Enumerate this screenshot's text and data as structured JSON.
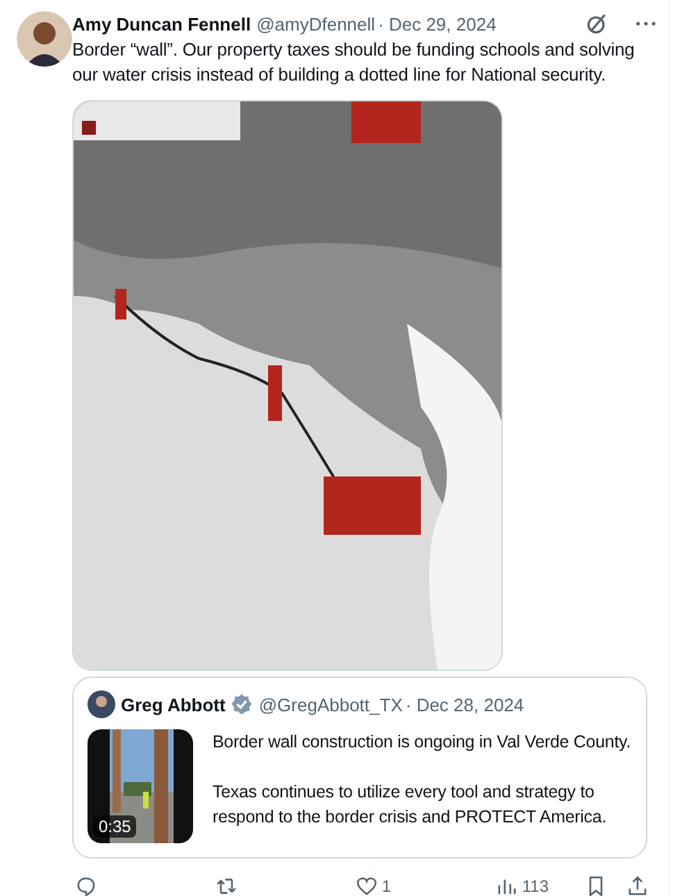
{
  "tweet": {
    "author": "Amy Duncan Fennell",
    "handle": "@amyDfennell",
    "date": "· Dec 29, 2024",
    "text": "Border “wall”. Our property taxes should be funding schools and solving our water crisis instead of building a dotted line for National security."
  },
  "quote": {
    "author": "Greg Abbott",
    "verified": true,
    "handle": "@GregAbbott_TX",
    "date": "· Dec 28, 2024",
    "video": {
      "kind": "picture",
      "duration": "0:35"
    },
    "paragraphs": [
      "Border wall construction is ongoing in Val Verde County.",
      "Texas continues to utilize every tool and strategy to respond to the border crisis and PROTECT America."
    ]
  },
  "actions": [
    {
      "kind": "reply"
    },
    {
      "kind": "repost"
    },
    {
      "kind": "like",
      "count": "1"
    },
    {
      "kind": "views",
      "count": "113"
    },
    {
      "kind": "bookmark"
    },
    {
      "kind": "share"
    }
  ]
}
